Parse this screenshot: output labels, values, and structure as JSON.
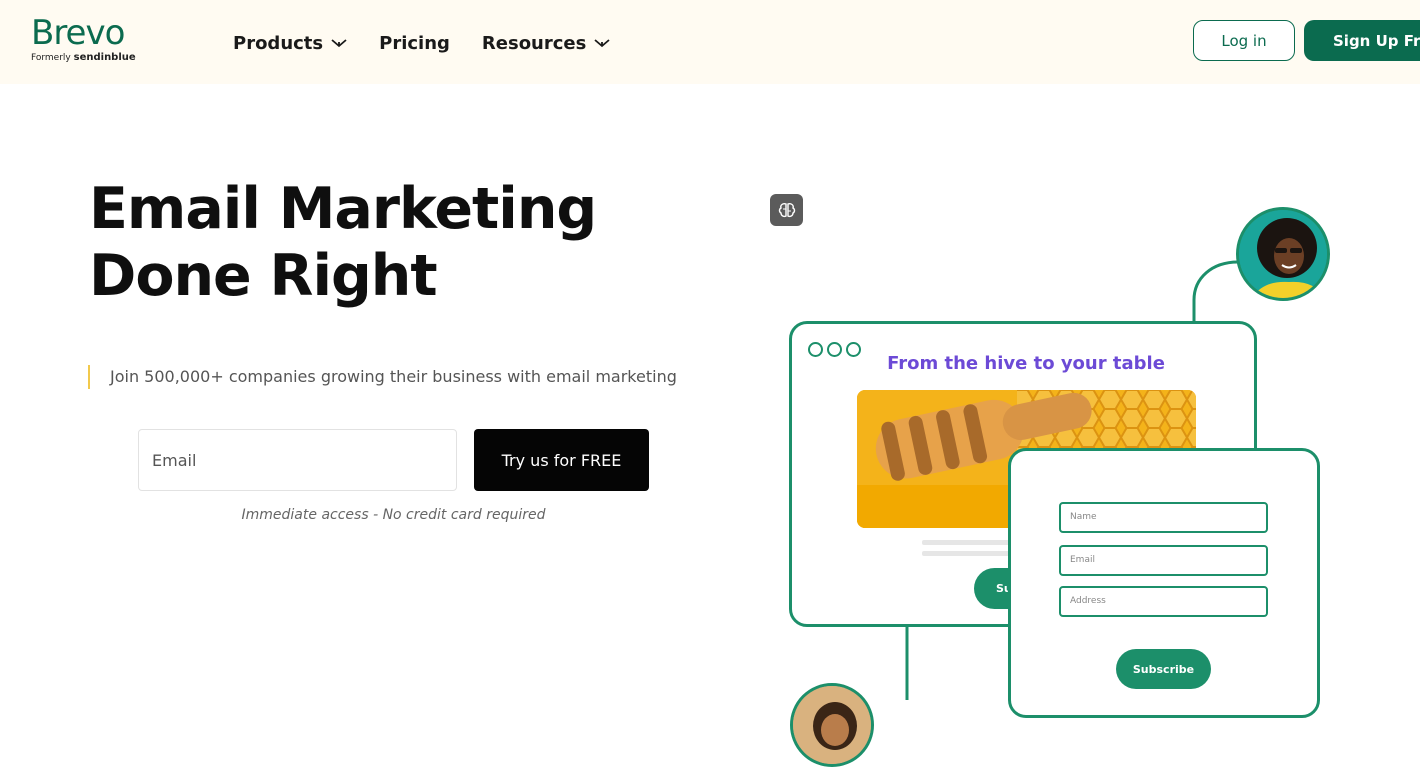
{
  "brand": {
    "name": "Brevo",
    "formerly_label": "Formerly",
    "formerly_name": "sendinblue",
    "color": "#0b6b4f"
  },
  "nav": {
    "items": [
      {
        "label": "Products",
        "has_dropdown": true
      },
      {
        "label": "Pricing",
        "has_dropdown": false
      },
      {
        "label": "Resources",
        "has_dropdown": true
      }
    ]
  },
  "header_actions": {
    "login_label": "Log in",
    "signup_label": "Sign Up Free"
  },
  "hero": {
    "title": "Email Marketing Done Right",
    "subtitle": "Join 500,000+ companies growing their business with email marketing",
    "email_placeholder": "Email",
    "cta_label": "Try us for FREE",
    "note": "Immediate access - No credit card required"
  },
  "illustration": {
    "newsletter_title": "From the hive to your table",
    "back_button_label": "Su",
    "form_fields": [
      {
        "placeholder": "Name"
      },
      {
        "placeholder": "Email"
      },
      {
        "placeholder": "Address"
      }
    ],
    "subscribe_label": "Subscribe",
    "accent_color": "#1c8f6a",
    "title_color": "#6c4ad6"
  },
  "icons": {
    "nav_dropdown": "chevron-down-icon",
    "ai_badge": "brain-icon",
    "window_dots": "window-dots-icon"
  }
}
